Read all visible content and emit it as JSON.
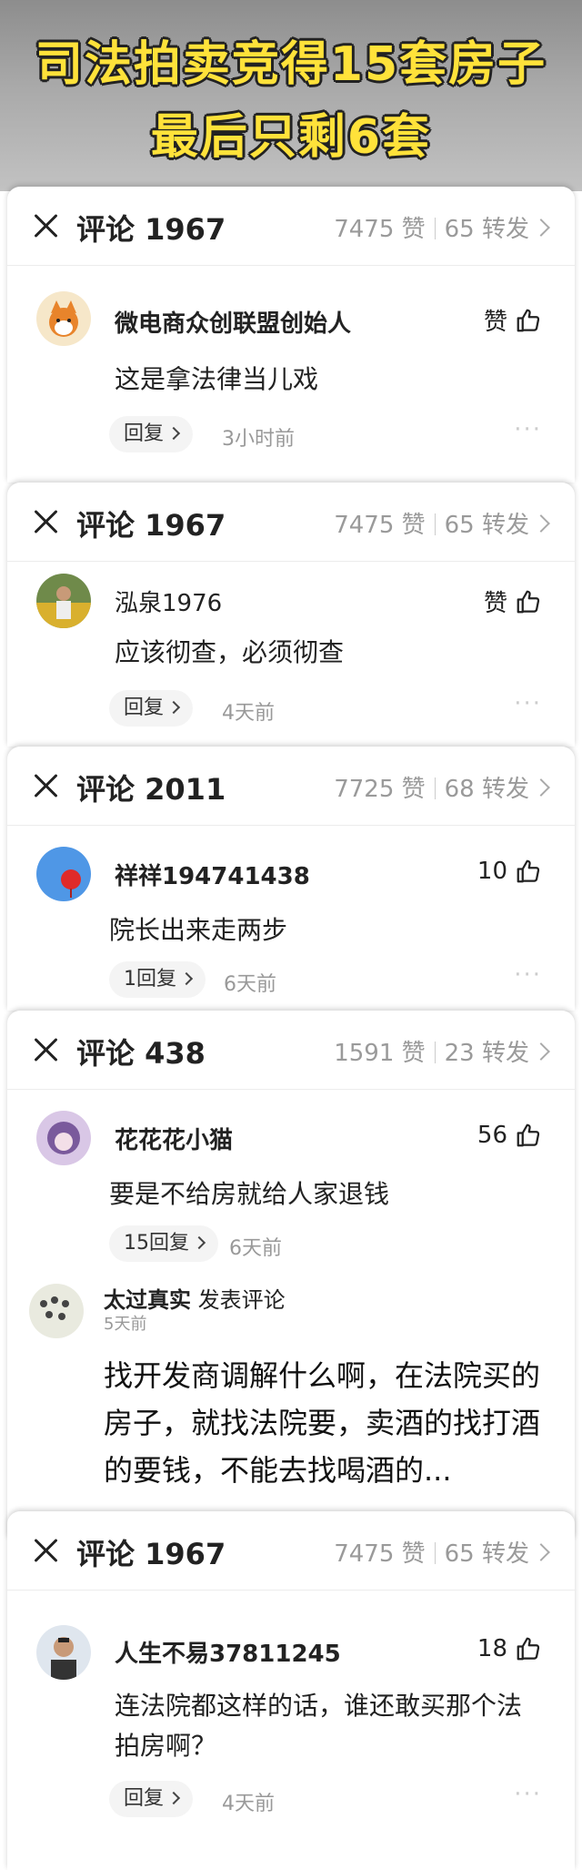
{
  "banner": {
    "line1": "司法拍卖竞得15套房子",
    "line2": "最后只剩6套"
  },
  "panels": [
    {
      "title": "评论 1967",
      "likes": "7475 赞",
      "shares": "65 转发",
      "user": "微电商众创联盟创始人",
      "like_label": "赞",
      "text": "这是拿法律当儿戏",
      "reply": "回复",
      "time": "3小时前"
    },
    {
      "title": "评论 1967",
      "likes": "7475 赞",
      "shares": "65 转发",
      "user": "泓泉1976",
      "like_label": "赞",
      "text": "应该彻查，必须彻查",
      "reply": "回复",
      "time": "4天前"
    },
    {
      "title": "评论 2011",
      "likes": "7725 赞",
      "shares": "68 转发",
      "user": "祥祥194741438",
      "like_label": "10",
      "text": "院长出来走两步",
      "reply": "1回复",
      "time": "6天前"
    },
    {
      "title": "评论 438",
      "likes": "1591 赞",
      "shares": "23 转发",
      "user": "花花花小猫",
      "like_label": "56",
      "text": "要是不给房就给人家退钱",
      "reply": "15回复",
      "time": "6天前"
    },
    {
      "title": "评论 1967",
      "likes": "7475 赞",
      "shares": "65 转发",
      "user": "人生不易37811245",
      "like_label": "18",
      "text": "连法院都这样的话，谁还敢买那个法拍房啊？",
      "reply": "回复",
      "time": "4天前"
    }
  ],
  "post": {
    "user": "太过真实",
    "action": "发表评论",
    "time": "5天前",
    "body": "找开发商调解什么啊，在法院买的房子，就找法院要，卖酒的找打酒的要钱，不能去找喝酒的..."
  },
  "icons": {
    "close": "close-icon",
    "chevron": "chevron-right-icon",
    "like": "thumbs-up-icon",
    "more": "more-dots-icon"
  }
}
